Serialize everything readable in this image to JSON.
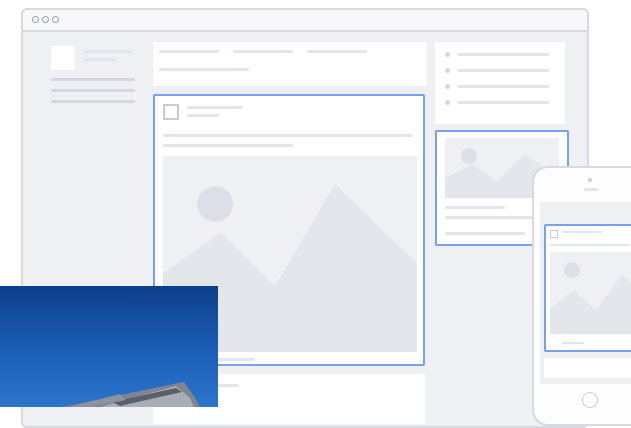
{
  "window": {
    "title": ""
  },
  "colors": {
    "highlight": "#7b9fe8",
    "placeholder": "#eef0f3",
    "sky": "#1d5fb8"
  },
  "icons": {
    "window_dots": [
      "window-dot-icon",
      "window-dot-icon",
      "window-dot-icon"
    ],
    "page_avatar": "page-avatar-icon",
    "ad_image": "image-placeholder-icon",
    "phone_home": "home-button-icon"
  },
  "photo": {
    "sign_text": ""
  }
}
